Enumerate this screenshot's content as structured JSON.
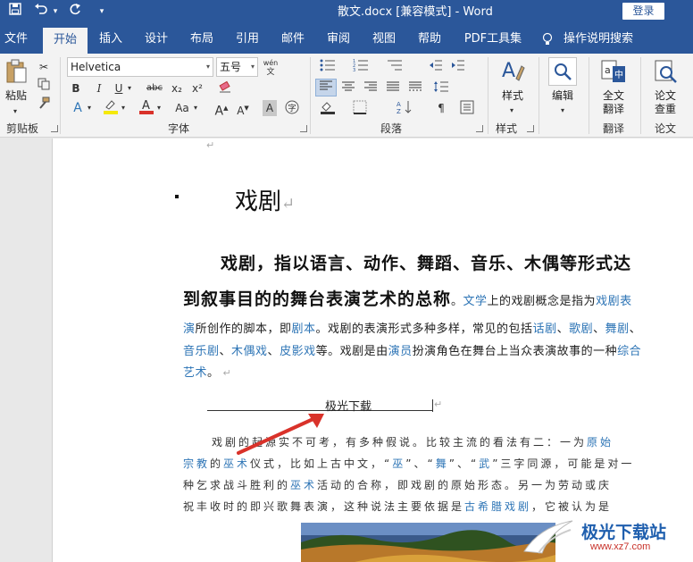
{
  "titlebar": {
    "doc_title": "散文.docx [兼容模式] - Word",
    "login": "登录",
    "qa_undo_arrow": "▾",
    "qa_more": "▾"
  },
  "tabs": [
    "文件",
    "开始",
    "插入",
    "设计",
    "布局",
    "引用",
    "邮件",
    "审阅",
    "视图",
    "帮助",
    "PDF工具集"
  ],
  "tell_me": "操作说明搜索",
  "ribbon": {
    "clipboard": {
      "paste": "粘贴",
      "label": "剪贴板"
    },
    "font": {
      "name": "Helvetica",
      "size": "五号",
      "label": "字体",
      "bold": "B",
      "italic": "I",
      "underline": "U",
      "strike": "abc",
      "sub": "x₂",
      "sup": "x²",
      "grow": "A",
      "shrink": "A",
      "case": "Aa",
      "wen": "wén"
    },
    "paragraph": {
      "label": "段落"
    },
    "styles": {
      "name": "样式",
      "label": "样式"
    },
    "editing": {
      "name": "编辑"
    },
    "translate": {
      "name1": "全文",
      "name2": "翻译",
      "label": "翻译"
    },
    "paper": {
      "name1": "论文",
      "name2": "查重",
      "label": "论文"
    }
  },
  "document": {
    "heading": "戏剧",
    "bold_line1": "戏剧，指以语言、动作、舞蹈、音乐、木偶等形式达",
    "bold_line2": "到叙事目的的舞台表演艺术的总称",
    "line2_tail": [
      {
        "t": "。",
        "link": false
      },
      {
        "t": "文学",
        "link": true
      },
      {
        "t": "上的戏剧概念是指为",
        "link": false
      },
      {
        "t": "戏剧表",
        "link": true
      }
    ],
    "line3": [
      {
        "t": "演",
        "link": true
      },
      {
        "t": "所创作的脚本，即",
        "link": false
      },
      {
        "t": "剧本",
        "link": true
      },
      {
        "t": "。戏剧的表演形式多种多样，常见的包括",
        "link": false
      },
      {
        "t": "话剧",
        "link": true
      },
      {
        "t": "、",
        "link": false
      },
      {
        "t": "歌剧",
        "link": true
      },
      {
        "t": "、",
        "link": false
      },
      {
        "t": "舞剧",
        "link": true
      },
      {
        "t": "、",
        "link": false
      }
    ],
    "line4": [
      {
        "t": "音乐剧",
        "link": true
      },
      {
        "t": "、",
        "link": false
      },
      {
        "t": "木偶戏",
        "link": true
      },
      {
        "t": "、",
        "link": false
      },
      {
        "t": "皮影戏",
        "link": true
      },
      {
        "t": "等。戏剧是由",
        "link": false
      },
      {
        "t": "演员",
        "link": true
      },
      {
        "t": "扮演角色在舞台上当众表演故事的一种",
        "link": false
      },
      {
        "t": "综合",
        "link": true
      }
    ],
    "line5": [
      {
        "t": "艺术",
        "link": true
      },
      {
        "t": "。",
        "link": false
      }
    ],
    "caption": "极光下载",
    "para2_line1": [
      {
        "t": "戏剧的起源实不可考，有多种假说。比较主流的看法有二：一为",
        "link": false
      },
      {
        "t": "原始",
        "link": true
      }
    ],
    "para2_line2": [
      {
        "t": "宗教",
        "link": true
      },
      {
        "t": "的",
        "link": false
      },
      {
        "t": "巫术",
        "link": true
      },
      {
        "t": "仪式，比如上古中文，“",
        "link": false
      },
      {
        "t": "巫",
        "link": true
      },
      {
        "t": "”、“",
        "link": false
      },
      {
        "t": "舞",
        "link": true
      },
      {
        "t": "”、“",
        "link": false
      },
      {
        "t": "武",
        "link": true
      },
      {
        "t": "”三字同源，可能是对一",
        "link": false
      }
    ],
    "para2_line3": [
      {
        "t": "种乞求战斗胜利的",
        "link": false
      },
      {
        "t": "巫术",
        "link": true
      },
      {
        "t": "活动的合称，即戏剧的原始形态。另一为劳动或庆",
        "link": false
      }
    ],
    "para2_line4": [
      {
        "t": "祝丰收时的即兴歌舞表演，这种说法主要依据是",
        "link": false
      },
      {
        "t": "古希腊戏剧",
        "link": true
      },
      {
        "t": "，它被认为是",
        "link": false
      }
    ]
  },
  "watermark": {
    "text": "极光下载站",
    "url": "www.xz7.com"
  },
  "colors": {
    "brand": "#2b579a",
    "link": "#2e75b6",
    "arrow": "#d9322a"
  }
}
